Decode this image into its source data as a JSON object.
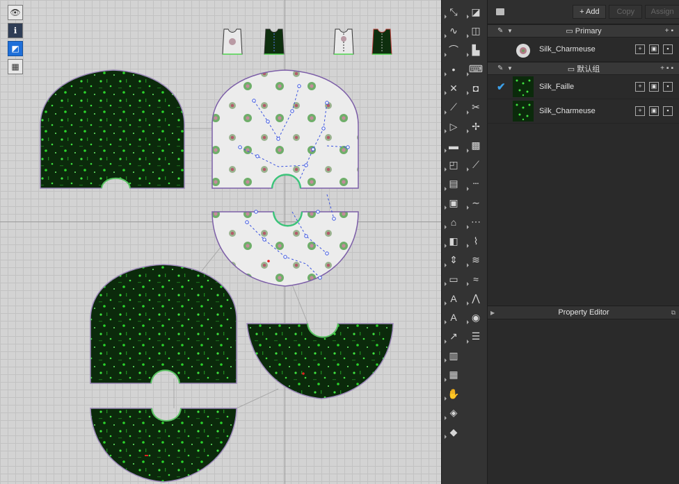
{
  "object_browser": {
    "add_label": "+ Add",
    "copy_label": "Copy",
    "assign_label": "Assign",
    "groups": [
      {
        "title": "Primary",
        "items": [
          {
            "name": "Silk_Charmeuse",
            "selected": false,
            "swatch": "floral"
          }
        ]
      },
      {
        "title": "默认组",
        "items": [
          {
            "name": "Silk_Faille",
            "selected": true,
            "swatch": "green-dots"
          },
          {
            "name": "Silk_Charmeuse",
            "selected": false,
            "swatch": "green-dots"
          }
        ]
      }
    ]
  },
  "property_editor": {
    "title": "Property Editor"
  },
  "view_tools": [
    {
      "icon": "avatar-visibility-icon"
    },
    {
      "icon": "info-icon"
    },
    {
      "icon": "fabric-view-icon"
    },
    {
      "icon": "garment-view-icon"
    }
  ],
  "colors": {
    "canvas_bg": "#d3d3d3",
    "grid": "#c2c2c2",
    "outline": "#7d5fa8",
    "fabric_dark": "#0b2a0b",
    "fabric_dot": "#3fe23f",
    "selected_check": "#3ca0e8"
  }
}
